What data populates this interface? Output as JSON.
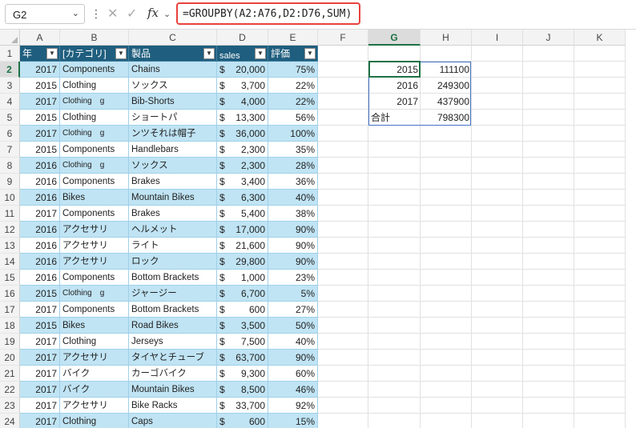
{
  "formula_bar": {
    "name_box": "G2",
    "fx_label": "fx",
    "formula": "=GROUPBY(A2:A76,D2:D76,SUM)"
  },
  "columns": [
    "A",
    "B",
    "C",
    "D",
    "E",
    "F",
    "G",
    "H",
    "I",
    "J",
    "K"
  ],
  "rows": [
    "1",
    "2",
    "3",
    "4",
    "5",
    "6",
    "7",
    "8",
    "9",
    "10",
    "11",
    "12",
    "13",
    "14",
    "15",
    "16",
    "17",
    "18",
    "19",
    "20",
    "21",
    "22",
    "23",
    "24"
  ],
  "table_headers": [
    "年",
    "[カテゴリ]",
    "製品",
    "sales",
    "評価"
  ],
  "table_rows": [
    [
      "2017",
      "Components",
      "Chains",
      "$",
      "20,000",
      "75%"
    ],
    [
      "2015",
      "Clothing",
      "ソックス",
      "$",
      "3,700",
      "22%"
    ],
    [
      "2017",
      "Clothing　g",
      "Bib-Shorts",
      "$",
      "4,000",
      "22%"
    ],
    [
      "2015",
      "Clothing",
      "ショートパ",
      "$",
      "13,300",
      "56%"
    ],
    [
      "2017",
      "Clothing　g",
      "ンツそれは帽子",
      "$",
      "36,000",
      "100%"
    ],
    [
      "2015",
      "Components",
      "Handlebars",
      "$",
      "2,300",
      "35%"
    ],
    [
      "2016",
      "Clothing　g",
      "ソックス",
      "$",
      "2,300",
      "28%"
    ],
    [
      "2016",
      "Components",
      "Brakes",
      "$",
      "3,400",
      "36%"
    ],
    [
      "2016",
      "Bikes",
      "Mountain Bikes",
      "$",
      "6,300",
      "40%"
    ],
    [
      "2017",
      "Components",
      "Brakes",
      "$",
      "5,400",
      "38%"
    ],
    [
      "2016",
      "アクセサリ",
      "ヘルメット",
      "$",
      "17,000",
      "90%"
    ],
    [
      "2016",
      "アクセサリ",
      "ライト",
      "$",
      "21,600",
      "90%"
    ],
    [
      "2016",
      "アクセサリ",
      "ロック",
      "$",
      "29,800",
      "90%"
    ],
    [
      "2016",
      "Components",
      "Bottom Brackets",
      "$",
      "1,000",
      "23%"
    ],
    [
      "2015",
      "Clothing　g",
      "ジャージー",
      "$",
      "6,700",
      "5%"
    ],
    [
      "2017",
      "Components",
      "Bottom Brackets",
      "$",
      "600",
      "27%"
    ],
    [
      "2015",
      "Bikes",
      "Road Bikes",
      "$",
      "3,500",
      "50%"
    ],
    [
      "2017",
      "Clothing",
      "Jerseys",
      "$",
      "7,500",
      "40%"
    ],
    [
      "2017",
      "アクセサリ",
      "タイヤとチューブ",
      "$",
      "63,700",
      "90%"
    ],
    [
      "2017",
      "バイク",
      "カーゴバイク",
      "$",
      "9,300",
      "60%"
    ],
    [
      "2017",
      "バイク",
      "Mountain Bikes",
      "$",
      "8,500",
      "46%"
    ],
    [
      "2017",
      "アクセサリ",
      "Bike Racks",
      "$",
      "33,700",
      "92%"
    ],
    [
      "2017",
      "Clothing",
      "Caps",
      "$",
      "600",
      "15%"
    ]
  ],
  "groupby_result": [
    [
      "2015",
      "111100"
    ],
    [
      "2016",
      "249300"
    ],
    [
      "2017",
      "437900"
    ],
    [
      "合計",
      "798300"
    ]
  ],
  "colors": {
    "header_blue": "#1f5e7e",
    "band_blue": "#c0e4f4",
    "selection_green": "#1e7145",
    "formula_highlight": "#e8413c",
    "result_border": "#4472c4"
  }
}
